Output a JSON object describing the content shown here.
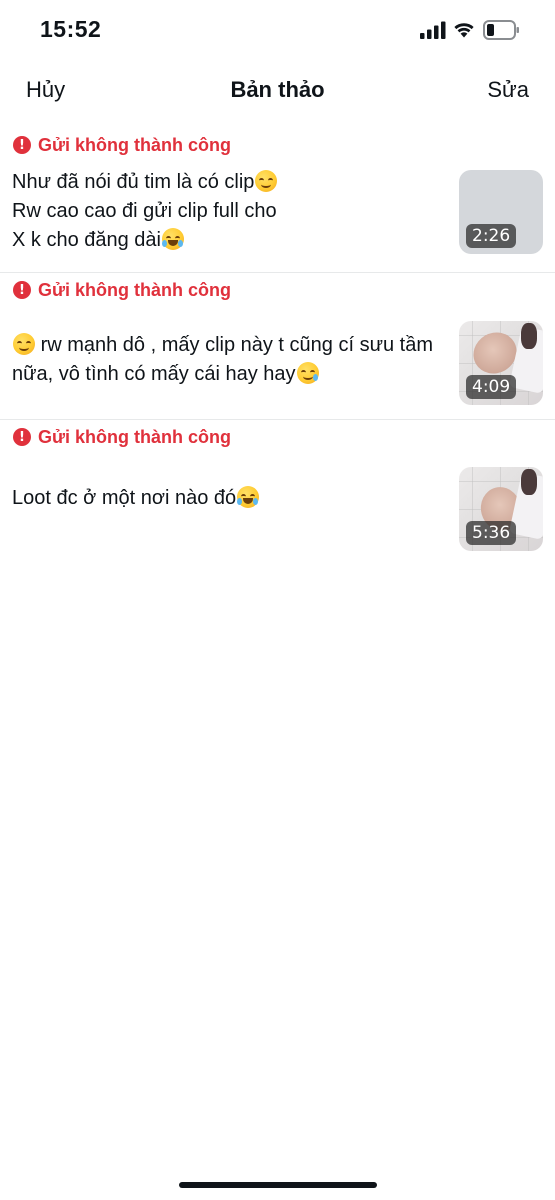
{
  "status_bar": {
    "time": "15:52"
  },
  "nav": {
    "cancel_label": "Hủy",
    "title": "Bản thảo",
    "edit_label": "Sửa"
  },
  "error_color": "#e0313c",
  "drafts": [
    {
      "error_text": "Gửi không thành công",
      "lines": [
        "Như đã nói đủ tim là có clip",
        "Rw cao cao đi gửi clip full cho",
        "X k cho đăng dài"
      ],
      "emojis": [
        "smiling-face-icon",
        "laughing-tears-icon"
      ],
      "duration": "2:26"
    },
    {
      "error_text": "Gửi không thành công",
      "text_a": "rw mạnh dô , mấy clip này t cũng cí sưu tầm nữa, vô tình có mấy cái hay hay",
      "emojis": [
        "smiling-face-icon",
        "crying-face-icon"
      ],
      "duration": "4:09"
    },
    {
      "error_text": "Gửi không thành công",
      "text_a": "Loot đc ở một nơi nào đó",
      "emojis": [
        "laughing-tears-icon"
      ],
      "duration": "5:36"
    }
  ]
}
